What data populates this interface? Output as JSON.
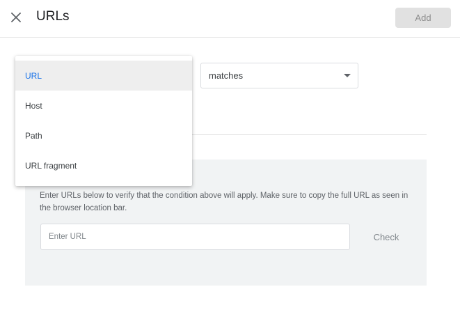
{
  "header": {
    "title": "URLs",
    "close_icon": "close-icon",
    "add_label": "Add"
  },
  "condition": {
    "type_options": [
      {
        "label": "URL",
        "selected": true
      },
      {
        "label": "Host",
        "selected": false
      },
      {
        "label": "Path",
        "selected": false
      },
      {
        "label": "URL fragment",
        "selected": false
      }
    ],
    "match_value": "matches",
    "match_icon": "chevron-down-icon"
  },
  "verify": {
    "description": "Enter URLs below to verify that the condition above will apply. Make sure to copy the full URL as seen in the browser location bar.",
    "url_placeholder": "Enter URL",
    "url_value": "",
    "check_label": "Check"
  },
  "colors": {
    "accent": "#1a73e8",
    "panel_bg": "#f1f3f4",
    "disabled_button": "#e1e1e1"
  }
}
